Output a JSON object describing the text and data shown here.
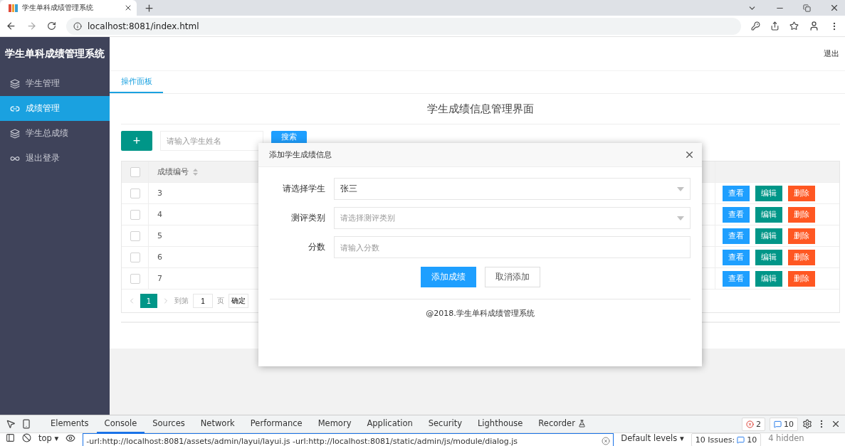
{
  "browser": {
    "tab_title": "学生单科成绩管理系统",
    "address": "localhost:8081/index.html"
  },
  "sidebar": {
    "title": "学生单科成绩管理系统",
    "items": [
      {
        "label": "学生管理",
        "kind": "layers",
        "selected": false
      },
      {
        "label": "成绩管理",
        "kind": "link",
        "selected": true
      },
      {
        "label": "学生总成绩",
        "kind": "layers",
        "selected": false
      },
      {
        "label": "退出登录",
        "kind": "logout",
        "selected": false
      }
    ]
  },
  "header": {
    "logout": "退出"
  },
  "tabs": [
    {
      "label": "操作面板",
      "selected": true
    }
  ],
  "page_title": "学生成绩信息管理界面",
  "toolbar": {
    "add_button": "+",
    "search": {
      "placeholder": "请输入学生姓名"
    },
    "search_button": "搜索"
  },
  "table": {
    "header_checked": false,
    "columns": [
      "成绩编号"
    ],
    "rows": [
      {
        "id": "3",
        "checked": false,
        "actions": [
          {
            "label": "查看",
            "kind": "view"
          },
          {
            "label": "编辑",
            "kind": "edit"
          },
          {
            "label": "删除",
            "kind": "delete"
          }
        ]
      },
      {
        "id": "4",
        "checked": false,
        "actions": [
          {
            "label": "查看",
            "kind": "view"
          },
          {
            "label": "编辑",
            "kind": "edit"
          },
          {
            "label": "删除",
            "kind": "delete"
          }
        ]
      },
      {
        "id": "5",
        "checked": false,
        "actions": [
          {
            "label": "查看",
            "kind": "view"
          },
          {
            "label": "编辑",
            "kind": "edit"
          },
          {
            "label": "删除",
            "kind": "delete"
          }
        ]
      },
      {
        "id": "6",
        "checked": false,
        "actions": [
          {
            "label": "查看",
            "kind": "view"
          },
          {
            "label": "编辑",
            "kind": "edit"
          },
          {
            "label": "删除",
            "kind": "delete"
          }
        ]
      },
      {
        "id": "7",
        "checked": false,
        "actions": [
          {
            "label": "查看",
            "kind": "view"
          },
          {
            "label": "编辑",
            "kind": "edit"
          },
          {
            "label": "删除",
            "kind": "delete"
          }
        ]
      }
    ]
  },
  "pagination": {
    "pages": [
      {
        "label": "1",
        "selected": true
      }
    ],
    "goto_label": "到第",
    "goto_value": "1",
    "page_unit": "页",
    "confirm": "确定"
  },
  "modal": {
    "title": "添加学生成绩信息",
    "fields": [
      {
        "kind": "select",
        "label": "请选择学生",
        "value": "张三"
      },
      {
        "kind": "select",
        "label": "测评类别",
        "placeholder": "请选择测评类别"
      },
      {
        "kind": "input",
        "label": "分数",
        "placeholder": "请输入分数"
      }
    ],
    "buttons": [
      {
        "label": "添加成绩",
        "kind": "primary"
      },
      {
        "label": "取消添加",
        "kind": "default"
      }
    ],
    "footer": "@2018.学生单科成绩管理系统"
  },
  "devtools": {
    "tabs": [
      {
        "label": "Elements",
        "selected": false
      },
      {
        "label": "Console",
        "selected": true
      },
      {
        "label": "Sources",
        "selected": false
      },
      {
        "label": "Network",
        "selected": false
      },
      {
        "label": "Performance",
        "selected": false
      },
      {
        "label": "Memory",
        "selected": false
      },
      {
        "label": "Application",
        "selected": false
      },
      {
        "label": "Security",
        "selected": false
      },
      {
        "label": "Lighthouse",
        "selected": false
      },
      {
        "label": "Recorder",
        "selected": false
      }
    ],
    "errors": "2",
    "messages": "10",
    "context": "top",
    "context_caret": "▾",
    "filter": "-url:http://localhost:8081/assets/admin/layui/layui.js -url:http://localhost:8081/static/admin/js/module/dialog.js",
    "levels": "Default levels",
    "levels_caret": "▾",
    "issues_label": "10 Issues:",
    "issues_count": "10",
    "hidden": "4 hidden"
  }
}
